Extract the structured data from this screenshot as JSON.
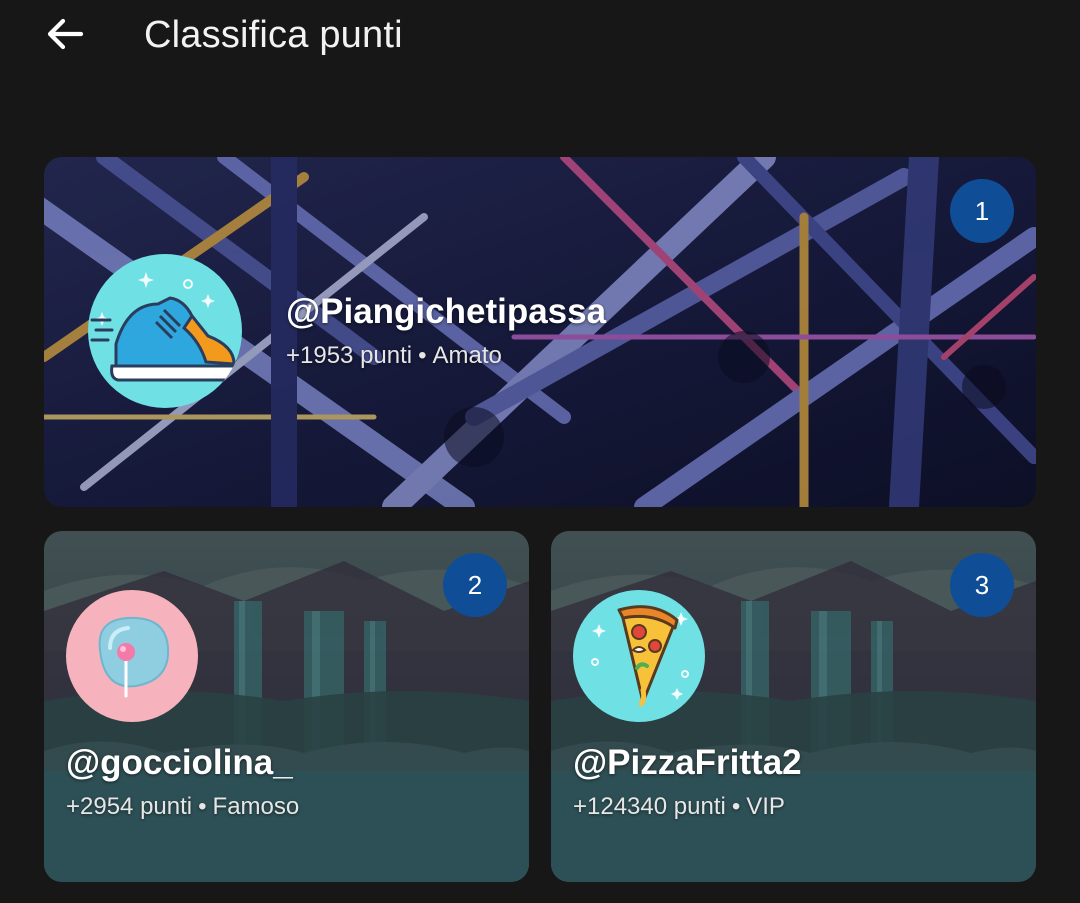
{
  "appbar": {
    "back_icon": "arrow-left-icon",
    "title": "Classifica punti"
  },
  "leaderboard": [
    {
      "rank": "1",
      "username": "@Piangichetipassa",
      "points": "+1953 punti",
      "separator": "•",
      "level": "Amato",
      "avatar_icon": "sneaker-icon",
      "background": "neon-ferris-wheel"
    },
    {
      "rank": "2",
      "username": "@gocciolina_",
      "points": "+2954 punti",
      "separator": "•",
      "level": "Famoso",
      "avatar_icon": "lollipop-drop-icon",
      "background": "waterfall-night"
    },
    {
      "rank": "3",
      "username": "@PizzaFritta2",
      "points": "+124340 punti",
      "separator": "•",
      "level": "VIP",
      "avatar_icon": "pizza-slice-icon",
      "background": "waterfall-night"
    }
  ],
  "colors": {
    "background": "#171717",
    "badge": "#0f4e96",
    "text": "#ffffff"
  }
}
